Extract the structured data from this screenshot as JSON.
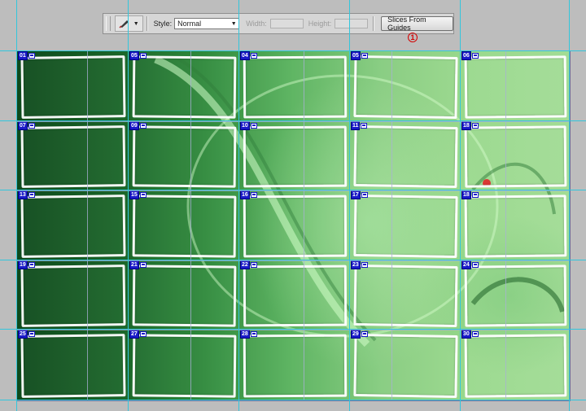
{
  "options_bar": {
    "tool_icon": "slice-tool-icon",
    "style_label": "Style:",
    "style_value": "Normal",
    "width_label": "Width:",
    "width_value": "",
    "height_label": "Height:",
    "height_value": "",
    "slices_button_label": "Slices From Guides"
  },
  "callout": {
    "label": "1",
    "color": "#d40000"
  },
  "colors": {
    "guide": "#33c6dc",
    "slice_badge": "#1a1ac8"
  },
  "slices": [
    {
      "id": "01"
    },
    {
      "id": "05"
    },
    {
      "id": "04"
    },
    {
      "id": "05"
    },
    {
      "id": "06"
    },
    {
      "id": "07"
    },
    {
      "id": "09"
    },
    {
      "id": "10"
    },
    {
      "id": "11"
    },
    {
      "id": "18"
    },
    {
      "id": "13"
    },
    {
      "id": "15"
    },
    {
      "id": "16"
    },
    {
      "id": "17"
    },
    {
      "id": "18"
    },
    {
      "id": "19"
    },
    {
      "id": "21"
    },
    {
      "id": "22"
    },
    {
      "id": "23"
    },
    {
      "id": "24"
    },
    {
      "id": "25"
    },
    {
      "id": "27"
    },
    {
      "id": "28"
    },
    {
      "id": "29"
    },
    {
      "id": "30"
    }
  ]
}
